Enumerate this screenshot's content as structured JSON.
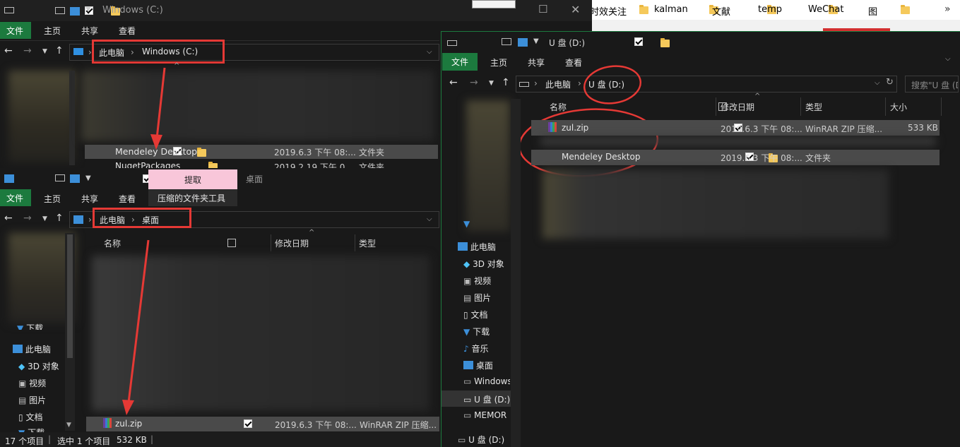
{
  "bookmarks": {
    "items": [
      "时效关注",
      "kalman",
      "文献",
      "temp",
      "WeChat",
      "图"
    ]
  },
  "win_c": {
    "title": "Windows (C:)",
    "ribbon": [
      "文件",
      "主页",
      "共享",
      "查看"
    ],
    "crumb": [
      "此电脑",
      "Windows (C:)"
    ],
    "rows": [
      {
        "name": "Mendeley Desktop",
        "date": "2019.6.3 下午 08:...",
        "type": "文件夹"
      },
      {
        "name": "NugetPackages",
        "date": "2019.2.19 下午 0...",
        "type": "文件夹"
      }
    ]
  },
  "win_desk": {
    "context_tab": "提取",
    "title": "桌面",
    "ribbon": [
      "文件",
      "主页",
      "共享",
      "查看",
      "压缩的文件夹工具"
    ],
    "crumb": [
      "此电脑",
      "桌面"
    ],
    "columns": [
      "名称",
      "修改日期",
      "类型"
    ],
    "sidebar": [
      "下载",
      "此电脑",
      "3D 对象",
      "视频",
      "图片",
      "文档",
      "下载"
    ],
    "file": {
      "name": "zul.zip",
      "date": "2019.6.3 下午 08:...",
      "type": "WinRAR ZIP 压缩..."
    },
    "status": {
      "count": "17 个项目",
      "selected": "选中 1 个项目",
      "size": "532 KB"
    }
  },
  "win_u": {
    "title": "U 盘 (D:)",
    "ribbon": [
      "文件",
      "主页",
      "共享",
      "查看"
    ],
    "crumb": [
      "此电脑",
      "U 盘 (D:)"
    ],
    "search_placeholder": "搜索\"U 盘 (D:...\"",
    "columns": [
      "名称",
      "修改日期",
      "类型",
      "大小"
    ],
    "rows": [
      {
        "name": "zul.zip",
        "date": "2019.6.3 下午 08:...",
        "type": "WinRAR ZIP 压缩...",
        "size": "533 KB"
      },
      {
        "name": "Mendeley Desktop",
        "date": "2019.6.3 下午 08:...",
        "type": "文件夹",
        "size": ""
      }
    ],
    "sidebar": [
      "此电脑",
      "3D 对象",
      "视频",
      "图片",
      "文档",
      "下载",
      "音乐",
      "桌面",
      "Windows",
      "U 盘 (D:)",
      "MEMOR",
      "U 盘 (D:)"
    ]
  }
}
